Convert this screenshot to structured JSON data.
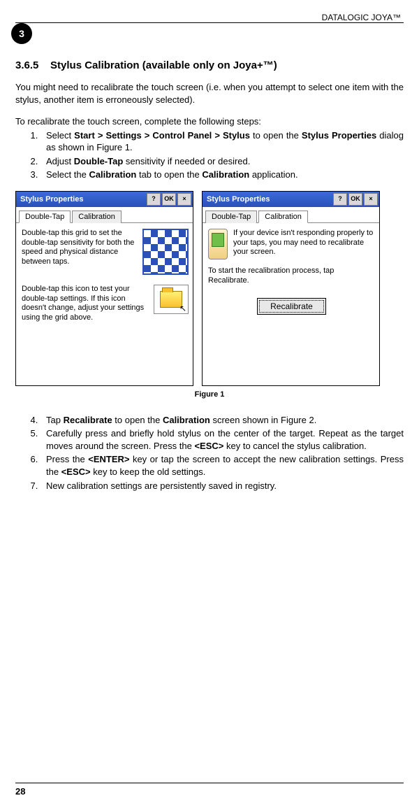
{
  "header": {
    "running_head": "DATALOGIC JOYA™",
    "chapter_badge": "3"
  },
  "section": {
    "number": "3.6.5",
    "title": "Stylus Calibration (available only on Joya+™)"
  },
  "intro_para": "You might need to recalibrate the touch screen (i.e. when you attempt to select one item with the stylus, another item is erroneously selected).",
  "recalibrate_lead": "To recalibrate the touch screen, complete the following steps:",
  "steps_a": [
    "Select Start > Settings > Control Panel > Stylus to open the Stylus Properties dialog as shown in Figure 1.",
    "Adjust Double-Tap sensitivity if needed or desired.",
    "Select the Calibration tab to open the Calibration application."
  ],
  "steps_a_html": [
    "Select <b>Start &gt; Settings &gt; Control Panel &gt; Stylus</b> to open the <b>Stylus Properties</b> dialog as shown in Figure 1.",
    "Adjust <b>Double-Tap</b> sensitivity if needed or desired.",
    "Select the <b>Calibration</b> tab to open the <b>Calibration</b> application."
  ],
  "figure": {
    "caption": "Figure 1",
    "left": {
      "title": "Stylus Properties",
      "btn_help": "?",
      "btn_ok": "OK",
      "btn_close": "×",
      "tab1": "Double-Tap",
      "tab2": "Calibration",
      "text1": "Double-tap this grid to set the double-tap sensitivity for both the speed and physical distance between taps.",
      "text2": "Double-tap this icon to test your double-tap settings. If this icon doesn't change, adjust your settings using the grid above."
    },
    "right": {
      "title": "Stylus Properties",
      "btn_help": "?",
      "btn_ok": "OK",
      "btn_close": "×",
      "tab1": "Double-Tap",
      "tab2": "Calibration",
      "text1": "If your device isn't responding properly to your taps, you may need to recalibrate your screen.",
      "text2": "To start the recalibration process, tap Recalibrate.",
      "button": "Recalibrate"
    }
  },
  "steps_b_start": 4,
  "steps_b_html": [
    "Tap <b>Recalibrate</b> to open the <b>Calibration</b> screen shown in Figure 2.",
    "Carefully press and briefly hold stylus on the center of the target. Repeat as the target moves around the screen. Press the <b>&lt;ESC&gt;</b> key to cancel the stylus calibration.",
    "Press the <b>&lt;ENTER&gt;</b> key or tap the screen to accept the new calibration settings. Press the <b>&lt;ESC&gt;</b> key to keep the old settings.",
    "New calibration settings are persistently saved in registry."
  ],
  "page_number": "28"
}
